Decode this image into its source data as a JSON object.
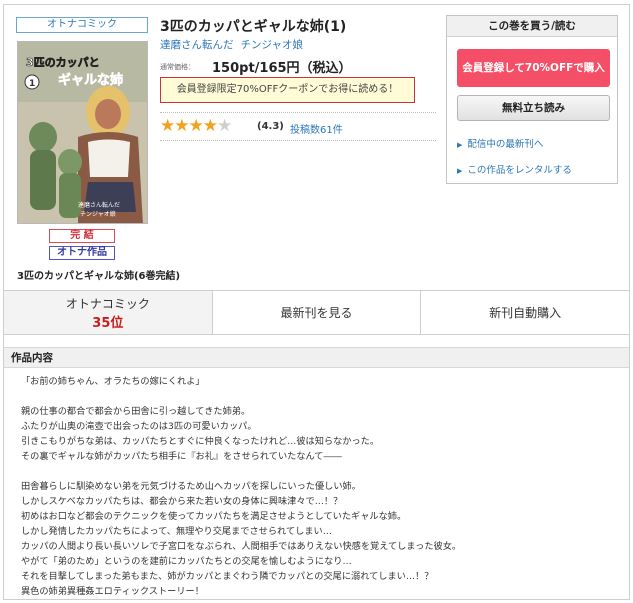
{
  "genre_tag": "オトナコミック",
  "title": "3匹のカッパとギャルな姉(1)",
  "authors": [
    "達磨さん転んだ",
    "チンジャオ娘"
  ],
  "price_label": "通常価格：",
  "price": "150pt/165円（税込）",
  "coupon": "会員登録限定70%OFFクーポンでお得に読める！",
  "rating": {
    "stars_filled": 4,
    "stars_total": 5,
    "value": "(4.3)",
    "reviews": "投稿数61件"
  },
  "cover_text": {
    "title_main": "3匹のカッパとギャルな姉",
    "volume": "1",
    "credit1": "達磨さん転んだ",
    "credit2": "チンジャオ娘"
  },
  "status_badge": "完 結",
  "adult_badge": "オトナ作品",
  "series_name": "3匹のカッパとギャルな姉(6巻完結)",
  "buy_panel": {
    "header": "この巻を買う/読む",
    "member_button": "会員登録して70%OFFで購入",
    "free_button": "無料立ち読み",
    "link_latest": "配信中の最新刊へ",
    "link_rental": "この作品をレンタルする"
  },
  "tabs": {
    "rank_label": "オトナコミック",
    "rank_value": "35位",
    "latest": "最新刊を見る",
    "auto_buy": "新刊自動購入"
  },
  "description_header": "作品内容",
  "description_lines": [
    "「お前の姉ちゃん、オラたちの嫁にくれよ」",
    "",
    "親の仕事の都合で都会から田舎に引っ越してきた姉弟。",
    "ふたりが山奥の滝壺で出会ったのは3匹の可愛いカッパ。",
    "引きこもりがちな弟は、カッパたちとすぐに仲良くなったけれど…彼は知らなかった。",
    "その裏でギャルな姉がカッパたち相手に『お礼』をさせられていたなんて――",
    "",
    "田舎暮らしに馴染めない弟を元気づけるため山へカッパを探しにいった優しい姉。",
    "しかしスケベなカッパたちは、都会から来た若い女の身体に興味津々で…！？",
    "初めはお口など都会のテクニックを使ってカッパたちを満足させようとしていたギャルな姉。",
    "しかし発情したカッパたちによって、無理やり交尾までさせられてしまい…",
    "カッパの人間より長い長いソレで子宮口をなぶられ、人間相手ではありえない快感を覚えてしまった彼女。",
    "やがて「弟のため」というのを建前にカッパたちとの交尾を愉しむようになり…",
    "それを目撃してしまった弟もまた、姉がカッパとまぐわう隣でカッパとの交尾に溺れてしまい…！？",
    "異色の姉弟異種姦エロティックストーリー！"
  ]
}
